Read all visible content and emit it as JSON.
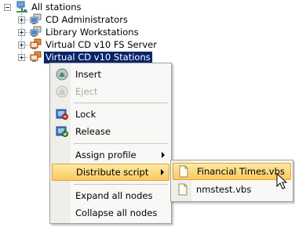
{
  "tree": {
    "root": {
      "label": "All stations",
      "icon": "network-computers-icon",
      "expanded": true
    },
    "children": [
      {
        "label": "CD Administrators",
        "icon": "workstation-group-icon"
      },
      {
        "label": "Library Workstations",
        "icon": "workstation-group-icon"
      },
      {
        "label": "Virtual CD v10 FS Server",
        "icon": "server-group-icon"
      },
      {
        "label": "Virtual CD v10 Stations",
        "icon": "server-group-icon",
        "selected": true
      }
    ]
  },
  "context_menu": {
    "items": [
      {
        "label": "Insert",
        "icon": "insert-disc-icon",
        "enabled": true
      },
      {
        "label": "Eject",
        "icon": "eject-disc-icon",
        "enabled": false
      },
      {
        "label": "Lock",
        "icon": "lock-icon",
        "enabled": true
      },
      {
        "label": "Release",
        "icon": "release-icon",
        "enabled": true
      },
      {
        "label": "Assign profile",
        "has_submenu": true
      },
      {
        "label": "Distribute script",
        "has_submenu": true,
        "highlighted": true
      },
      {
        "label": "Expand all nodes"
      },
      {
        "label": "Collapse all nodes"
      }
    ]
  },
  "submenu": {
    "items": [
      {
        "label": "Financial Times.vbs",
        "icon": "document-icon",
        "highlighted": true
      },
      {
        "label": "nmstest.vbs",
        "icon": "document-icon"
      }
    ]
  },
  "colors": {
    "selection_bg": "#0a246a",
    "menu_highlight_top": "#fde9a6",
    "menu_highlight_bottom": "#f9c95e",
    "menu_bg": "#f9f8f6"
  }
}
